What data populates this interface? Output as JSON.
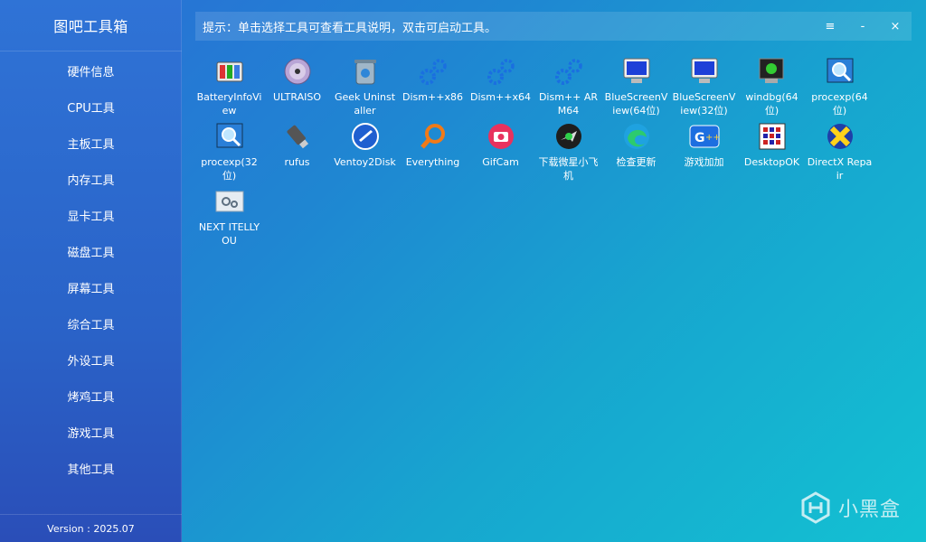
{
  "sidebar": {
    "title": "图吧工具箱",
    "items": [
      "硬件信息",
      "CPU工具",
      "主板工具",
      "内存工具",
      "显卡工具",
      "磁盘工具",
      "屏幕工具",
      "综合工具",
      "外设工具",
      "烤鸡工具",
      "游戏工具",
      "其他工具"
    ],
    "version": "Version : 2025.07"
  },
  "topbar": {
    "hint": "提示：单击选择工具可查看工具说明，双击可启动工具。",
    "menu_glyph": "≡",
    "minimize_glyph": "-",
    "close_glyph": "×"
  },
  "tools": [
    {
      "label": "BatteryInfoView",
      "icon": "battery-icon"
    },
    {
      "label": "ULTRAISO",
      "icon": "disc-icon"
    },
    {
      "label": "Geek Uninstaller",
      "icon": "trash-can-icon"
    },
    {
      "label": "Dism++x86",
      "icon": "gears-icon"
    },
    {
      "label": "Dism++x64",
      "icon": "gears-icon"
    },
    {
      "label": "Dism++ ARM64",
      "icon": "gears-icon"
    },
    {
      "label": "BlueScreenView(64位)",
      "icon": "monitor-icon"
    },
    {
      "label": "BlueScreenView(32位)",
      "icon": "monitor-icon"
    },
    {
      "label": "windbg(64位)",
      "icon": "debugger-icon"
    },
    {
      "label": "procexp(64位)",
      "icon": "magnifier-window-icon"
    },
    {
      "label": "procexp(32位)",
      "icon": "magnifier-window-icon"
    },
    {
      "label": "rufus",
      "icon": "usb-drive-icon"
    },
    {
      "label": "Ventoy2Disk",
      "icon": "ventoy-icon"
    },
    {
      "label": "Everything",
      "icon": "search-icon"
    },
    {
      "label": "GifCam",
      "icon": "camera-icon"
    },
    {
      "label": "下载微星小飞机",
      "icon": "airplane-icon"
    },
    {
      "label": "检查更新",
      "icon": "edge-icon"
    },
    {
      "label": "游戏加加",
      "icon": "gameplus-icon"
    },
    {
      "label": "DesktopOK",
      "icon": "desktop-grid-icon"
    },
    {
      "label": "DirectX Repair",
      "icon": "directx-icon"
    },
    {
      "label": "NEXT ITELLYOU",
      "icon": "settings-window-icon"
    }
  ],
  "watermark": {
    "text": "小黑盒"
  },
  "colors": {
    "sidebar": "#2a63c8",
    "accent": "#13c1d2",
    "text": "#ffffff"
  }
}
